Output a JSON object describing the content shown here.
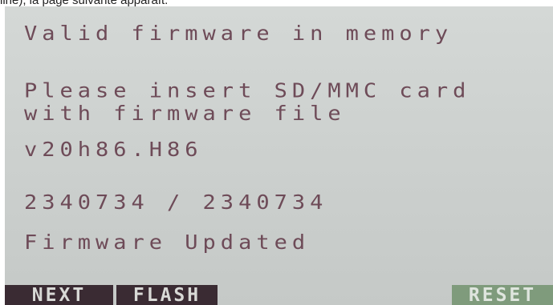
{
  "caption": "line), la page suivante apparaît.",
  "screen": {
    "lines": [
      "Valid firmware in memory",
      "Please insert SD/MMC card",
      "with firmware file",
      "v20h86.H86",
      "2340734 / 2340734",
      "Firmware Updated"
    ],
    "softkeys": {
      "next": "NEXT",
      "flash": "FLASH",
      "reset": "RESET"
    }
  },
  "colors": {
    "screen_bg": "#cdd1cf",
    "text": "#6e4b58",
    "key_dark": "#3a2b33",
    "key_green": "#7f9b7c"
  }
}
